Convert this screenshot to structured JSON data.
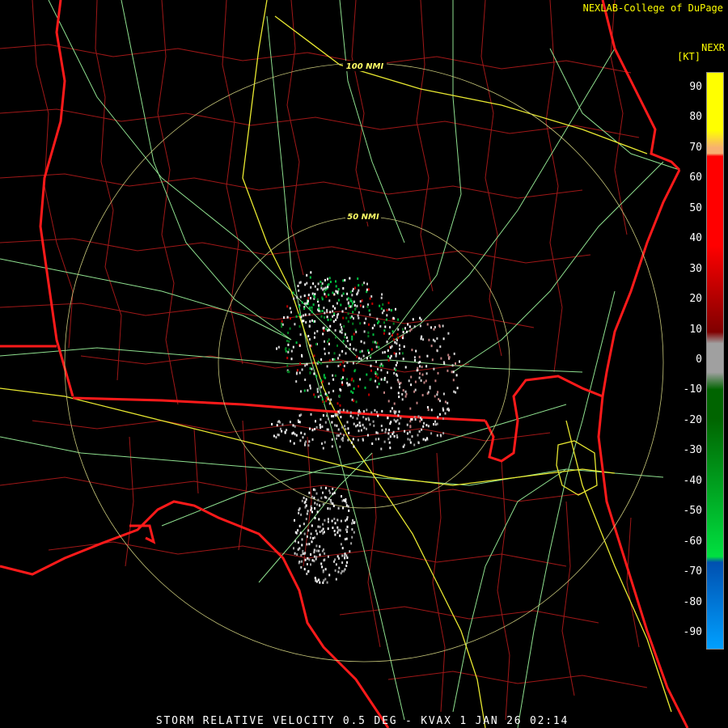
{
  "product": {
    "title": "STORM RELATIVE VELOCITY 0.5 DEG - KVAX 1 JAN 26 02:14",
    "credit": "NEXLAB-College of DuPage",
    "corner_label": "NEXR",
    "units": "[KT]"
  },
  "range_rings": [
    {
      "label": "50 NMI"
    },
    {
      "label": "100 NMI"
    }
  ],
  "legend": {
    "ticks": [
      90,
      80,
      70,
      60,
      50,
      40,
      30,
      20,
      10,
      0,
      -10,
      -20,
      -30,
      -40,
      -50,
      -60,
      -70,
      -80,
      -90
    ],
    "min": -95,
    "max": 95,
    "colors": {
      "top": "#ffff00",
      "orange": "#f7b070",
      "red_bright": "#ff0000",
      "red_dark": "#800000",
      "neutral": "#a0a0a0",
      "green_dark": "#006400",
      "green_bright": "#00e040",
      "blue_dark": "#0050b0",
      "blue_light": "#00a0ff"
    }
  },
  "map_colors": {
    "background": "#000000",
    "county_lines": "#a01818",
    "state_lines": "#ff1a1a",
    "highways": "#8fe08f",
    "interstates": "#e8e830",
    "range_rings": "#c8c87a"
  }
}
